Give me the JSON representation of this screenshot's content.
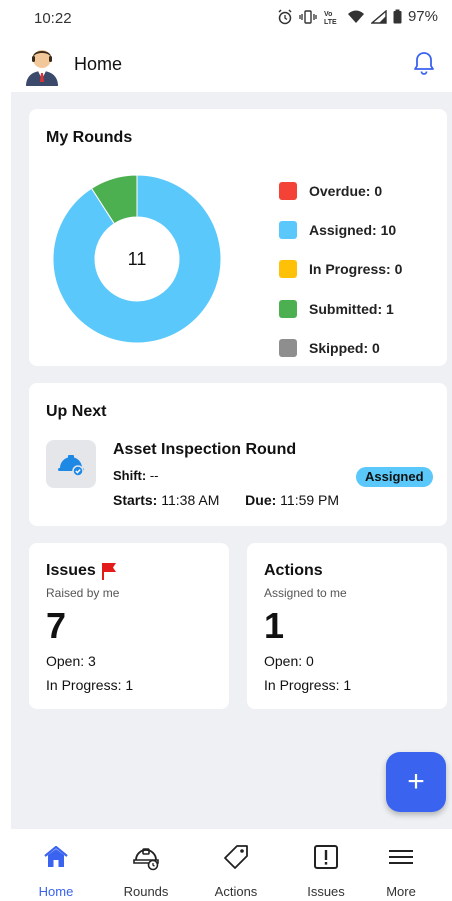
{
  "status_bar": {
    "time": "10:22",
    "battery": "97%"
  },
  "header": {
    "title": "Home"
  },
  "my_rounds": {
    "title": "My Rounds",
    "total": "11",
    "legend": [
      {
        "label": "Overdue: 0",
        "color": "#f44336"
      },
      {
        "label": "Assigned: 10",
        "color": "#5ac8fa"
      },
      {
        "label": "In Progress: 0",
        "color": "#ffc107"
      },
      {
        "label": "Submitted: 1",
        "color": "#4caf50"
      },
      {
        "label": "Skipped: 0",
        "color": "#8e8e8e"
      }
    ]
  },
  "chart_data": {
    "type": "pie",
    "categories": [
      "Overdue",
      "Assigned",
      "In Progress",
      "Submitted",
      "Skipped"
    ],
    "values": [
      0,
      10,
      0,
      1,
      0
    ],
    "colors": [
      "#f44336",
      "#5ac8fa",
      "#ffc107",
      "#4caf50",
      "#8e8e8e"
    ],
    "title": "My Rounds",
    "center_label": "11",
    "legend_position": "right"
  },
  "up_next": {
    "title": "Up Next",
    "round_name": "Asset Inspection Round",
    "shift_label": "Shift:",
    "shift_value": "--",
    "starts_label": "Starts:",
    "starts_value": "11:38 AM",
    "due_label": "Due:",
    "due_value": "11:59 PM",
    "status": "Assigned",
    "icon": "helmet-icon"
  },
  "issues": {
    "title": "Issues",
    "subtitle": "Raised by me",
    "count": "7",
    "open": "Open: 3",
    "in_progress": "In Progress: 1",
    "icon": "flag-icon"
  },
  "actions": {
    "title": "Actions",
    "subtitle": "Assigned to me",
    "count": "1",
    "open": "Open: 0",
    "in_progress": "In Progress: 1"
  },
  "fab": {
    "label": "+"
  },
  "bottom_nav": {
    "items": [
      {
        "label": "Home",
        "icon": "home-icon"
      },
      {
        "label": "Rounds",
        "icon": "helmet-icon"
      },
      {
        "label": "Actions",
        "icon": "tag-icon"
      },
      {
        "label": "Issues",
        "icon": "alert-icon"
      },
      {
        "label": "More",
        "icon": "menu-icon"
      }
    ]
  },
  "colors": {
    "accent": "#3a63f0",
    "background": "#eef0f4"
  }
}
